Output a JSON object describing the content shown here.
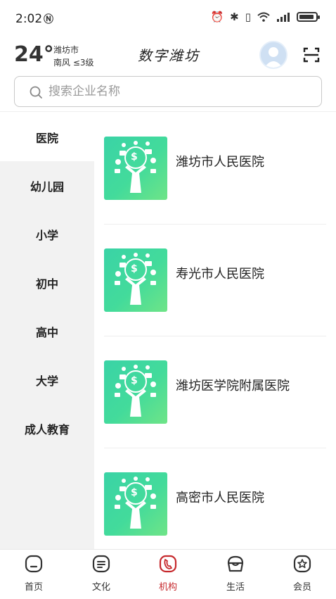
{
  "status_bar": {
    "time": "2:02",
    "nfc_icon": "nfc-icon",
    "alarm_icon": "alarm-icon",
    "bluetooth_icon": "bluetooth-icon",
    "vibrate_icon": "vibrate-icon",
    "wifi_icon": "wifi-icon",
    "signal_icon": "signal-icon",
    "battery_icon": "battery-icon"
  },
  "header": {
    "temperature": "24°",
    "city": "潍坊市",
    "wind": "南风 ≤3级",
    "logo_text": "数字潍坊"
  },
  "search": {
    "placeholder": "搜索企业名称",
    "value": ""
  },
  "categories": [
    {
      "label": "医院",
      "active": true
    },
    {
      "label": "幼儿园",
      "active": false
    },
    {
      "label": "小学",
      "active": false
    },
    {
      "label": "初中",
      "active": false
    },
    {
      "label": "高中",
      "active": false
    },
    {
      "label": "大学",
      "active": false
    },
    {
      "label": "成人教育",
      "active": false
    }
  ],
  "institutions": [
    {
      "name": "潍坊市人民医院",
      "thumb_icon": "money-tree-icon"
    },
    {
      "name": "寿光市人民医院",
      "thumb_icon": "money-tree-icon"
    },
    {
      "name": "潍坊医学院附属医院",
      "thumb_icon": "money-tree-icon"
    },
    {
      "name": "高密市人民医院",
      "thumb_icon": "money-tree-icon"
    }
  ],
  "tabbar": {
    "active_color": "#c6292d",
    "items": [
      {
        "label": "首页",
        "icon": "home-icon",
        "active": false
      },
      {
        "label": "文化",
        "icon": "culture-icon",
        "active": false
      },
      {
        "label": "机构",
        "icon": "institution-icon",
        "active": true
      },
      {
        "label": "生活",
        "icon": "life-icon",
        "active": false
      },
      {
        "label": "会员",
        "icon": "member-icon",
        "active": false
      }
    ]
  },
  "colors": {
    "thumb_start": "#3ad3a6",
    "thumb_end": "#6fe487",
    "sidebar_bg": "#f2f2f2"
  }
}
